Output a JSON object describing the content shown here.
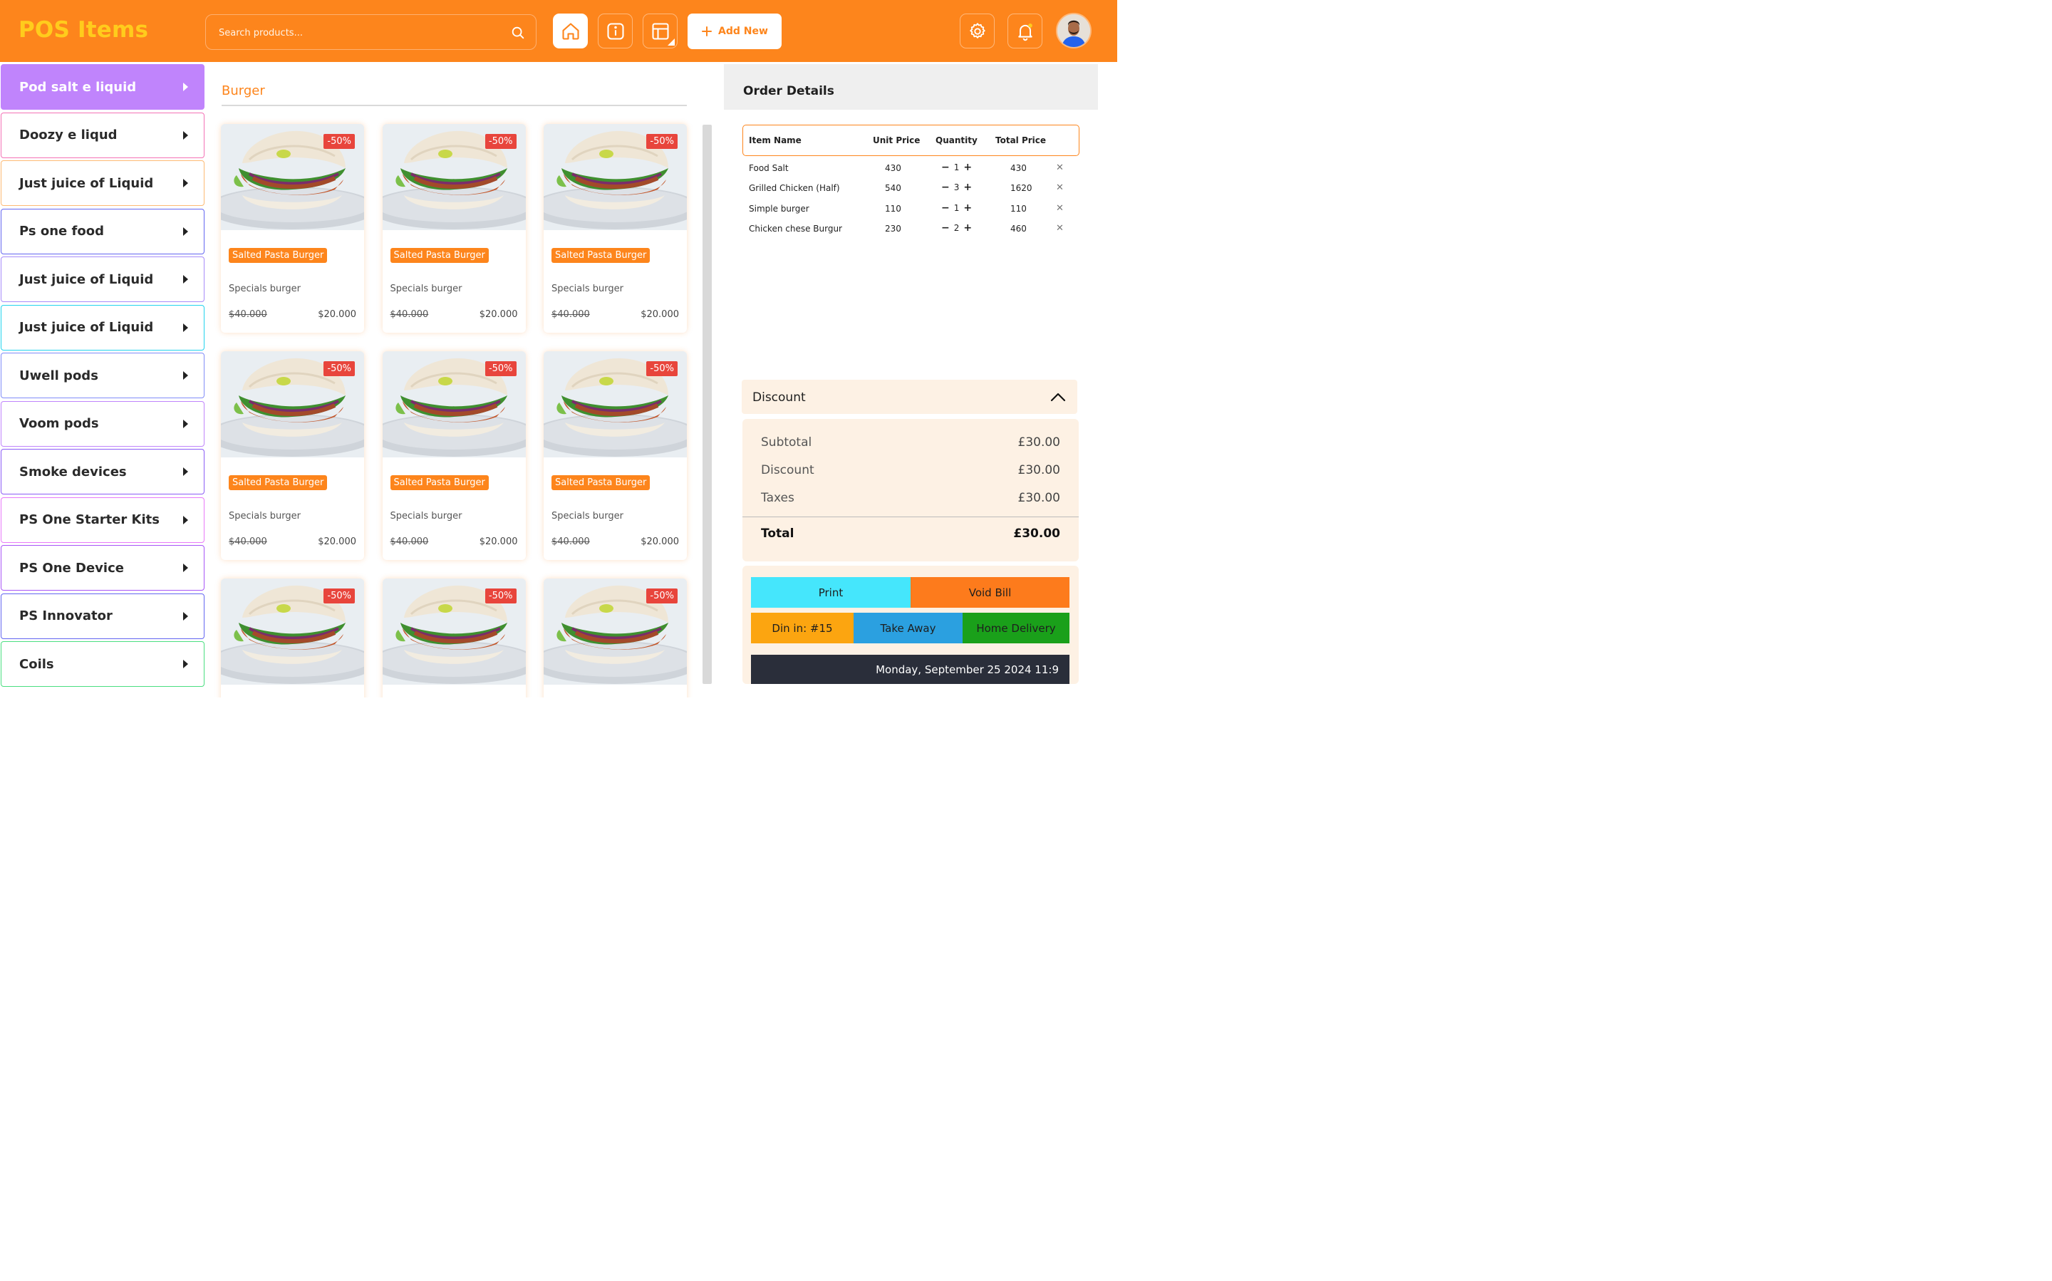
{
  "app": {
    "title": "POS Items",
    "search_placeholder": "Search products...",
    "add_new_label": "Add New"
  },
  "categories": [
    {
      "label": "Pod salt e liquid",
      "active": true,
      "border": "#c084fc"
    },
    {
      "label": "Doozy e liqud",
      "border": "#f472b6"
    },
    {
      "label": "Just juice of Liquid",
      "border": "#fdba74"
    },
    {
      "label": "Ps one food",
      "border": "#6366f1"
    },
    {
      "label": "Just juice of Liquid",
      "border": "#a78bfa"
    },
    {
      "label": "Just juice of Liquid",
      "border": "#22d3ee"
    },
    {
      "label": "Uwell pods",
      "border": "#818cf8"
    },
    {
      "label": "Voom pods",
      "border": "#c084fc"
    },
    {
      "label": "Smoke devices",
      "border": "#8b5cf6"
    },
    {
      "label": "PS One Starter Kits",
      "border": "#e879f9"
    },
    {
      "label": "PS One Device",
      "border": "#a855f7"
    },
    {
      "label": "PS Innovator",
      "border": "#6366f1"
    },
    {
      "label": "Coils",
      "border": "#4ade80"
    }
  ],
  "section": {
    "title": "Burger"
  },
  "products": [
    {
      "badge": "-50%",
      "tag": "Salted Pasta Burger",
      "subtitle": "Specials burger",
      "old_price": "$40.000",
      "price": "$20.000"
    },
    {
      "badge": "-50%",
      "tag": "Salted Pasta Burger",
      "subtitle": "Specials burger",
      "old_price": "$40.000",
      "price": "$20.000"
    },
    {
      "badge": "-50%",
      "tag": "Salted Pasta Burger",
      "subtitle": "Specials burger",
      "old_price": "$40.000",
      "price": "$20.000"
    },
    {
      "badge": "-50%",
      "tag": "Salted Pasta Burger",
      "subtitle": "Specials burger",
      "old_price": "$40.000",
      "price": "$20.000"
    },
    {
      "badge": "-50%",
      "tag": "Salted Pasta Burger",
      "subtitle": "Specials burger",
      "old_price": "$40.000",
      "price": "$20.000"
    },
    {
      "badge": "-50%",
      "tag": "Salted Pasta Burger",
      "subtitle": "Specials burger",
      "old_price": "$40.000",
      "price": "$20.000"
    },
    {
      "badge": "-50%",
      "tag": "",
      "subtitle": "",
      "old_price": "",
      "price": ""
    },
    {
      "badge": "-50%",
      "tag": "",
      "subtitle": "",
      "old_price": "",
      "price": ""
    },
    {
      "badge": "-50%",
      "tag": "",
      "subtitle": "",
      "old_price": "",
      "price": ""
    }
  ],
  "order": {
    "title": "Order Details",
    "columns": {
      "item": "Item Name",
      "unit": "Unit Price",
      "qty": "Quantity",
      "total": "Total Price"
    },
    "rows": [
      {
        "name": "Food Salt",
        "unit": "430",
        "qty": "1",
        "total": "430"
      },
      {
        "name": "Grilled Chicken (Half)",
        "unit": "540",
        "qty": "3",
        "total": "1620"
      },
      {
        "name": "Simple burger",
        "unit": "110",
        "qty": "1",
        "total": "110"
      },
      {
        "name": "Chicken chese Burgur",
        "unit": "230",
        "qty": "2",
        "total": "460"
      }
    ],
    "discount_label": "Discount",
    "summary": {
      "subtotal_label": "Subtotal",
      "subtotal": "£30.00",
      "discount_label": "Discount",
      "discount": "£30.00",
      "taxes_label": "Taxes",
      "taxes": "£30.00",
      "total_label": "Total",
      "total": "£30.00"
    },
    "actions": {
      "print": "Print",
      "void": "Void Bill",
      "dine_in": "Din in: #15",
      "take_away": "Take Away",
      "home_delivery": "Home Delivery"
    },
    "datetime": "Monday, September 25 2024 11:9"
  },
  "colors": {
    "brand_orange": "#fd851c",
    "logo_yellow": "#ffcc1c",
    "print_cyan": "#45e6fc",
    "void_orange": "#fd7b1c",
    "dine_yellow": "#fca510",
    "takeaway_blue": "#2ba0e0",
    "delivery_green": "#1aa01a"
  },
  "icons": {
    "search": "search-icon",
    "home": "home-icon",
    "info": "info-icon",
    "table": "table-icon",
    "plus": "plus-icon",
    "settings": "gear-icon",
    "notifications": "bell-icon"
  }
}
